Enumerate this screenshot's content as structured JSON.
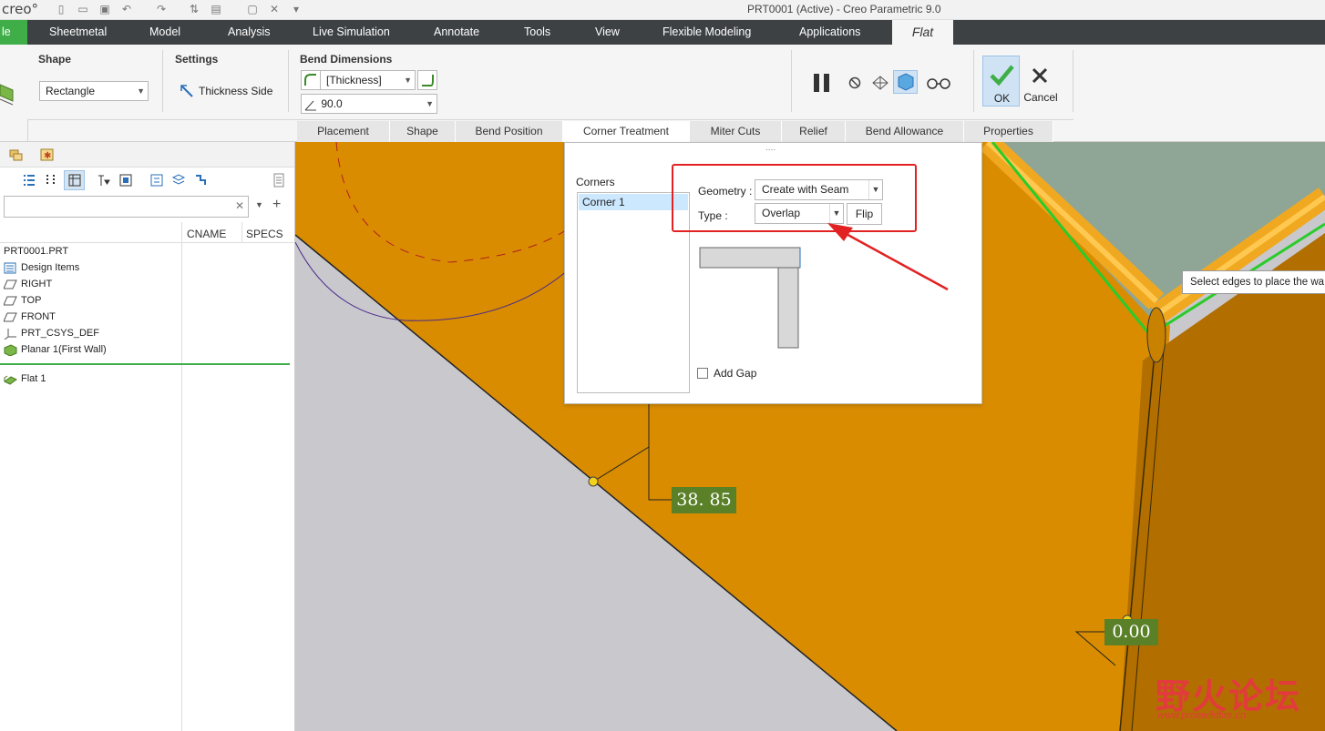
{
  "app": {
    "logo": "creo°",
    "window_title": "PRT0001 (Active) - Creo Parametric 9.0"
  },
  "ribbon_tabs": {
    "file": "le",
    "items": [
      "Sheetmetal",
      "Model",
      "Analysis",
      "Live Simulation",
      "Annotate",
      "Tools",
      "View",
      "Flexible Modeling",
      "Applications"
    ],
    "active": "Flat"
  },
  "ribbon": {
    "shape_group": {
      "title": "Shape",
      "value": "Rectangle"
    },
    "settings_group": {
      "title": "Settings",
      "thickness_side": "Thickness Side"
    },
    "bend_group": {
      "title": "Bend Dimensions",
      "thickness": "[Thickness]",
      "angle": "90.0"
    },
    "ok": "OK",
    "cancel": "Cancel"
  },
  "subtabs": [
    "Placement",
    "Shape",
    "Bend Position",
    "Corner Treatment",
    "Miter Cuts",
    "Relief",
    "Bend Allowance",
    "Properties"
  ],
  "model_tree": {
    "columns": [
      "CNAME",
      "SPECS"
    ],
    "items": [
      "PRT0001.PRT",
      "Design Items",
      "RIGHT",
      "TOP",
      "FRONT",
      "PRT_CSYS_DEF",
      "Planar 1(First Wall)",
      "Flat 1"
    ]
  },
  "corner_panel": {
    "handle": "....",
    "corners_label": "Corners",
    "corner_item": "Corner 1",
    "geometry_label": "Geometry :",
    "geometry_value": "Create with Seam",
    "type_label": "Type :",
    "type_value": "Overlap",
    "flip": "Flip",
    "add_gap": "Add Gap"
  },
  "viewport": {
    "tooltip": "Select edges to place the wa",
    "dim1": "38. 85",
    "dim2": "0.00"
  },
  "watermark": {
    "text": "野火论坛",
    "url": "www.proewildfire.cn"
  },
  "colors": {
    "orange": "#d98c00",
    "dark_orange": "#b26f00",
    "green_accent": "#3fae49",
    "highlight_red": "#e22222"
  }
}
